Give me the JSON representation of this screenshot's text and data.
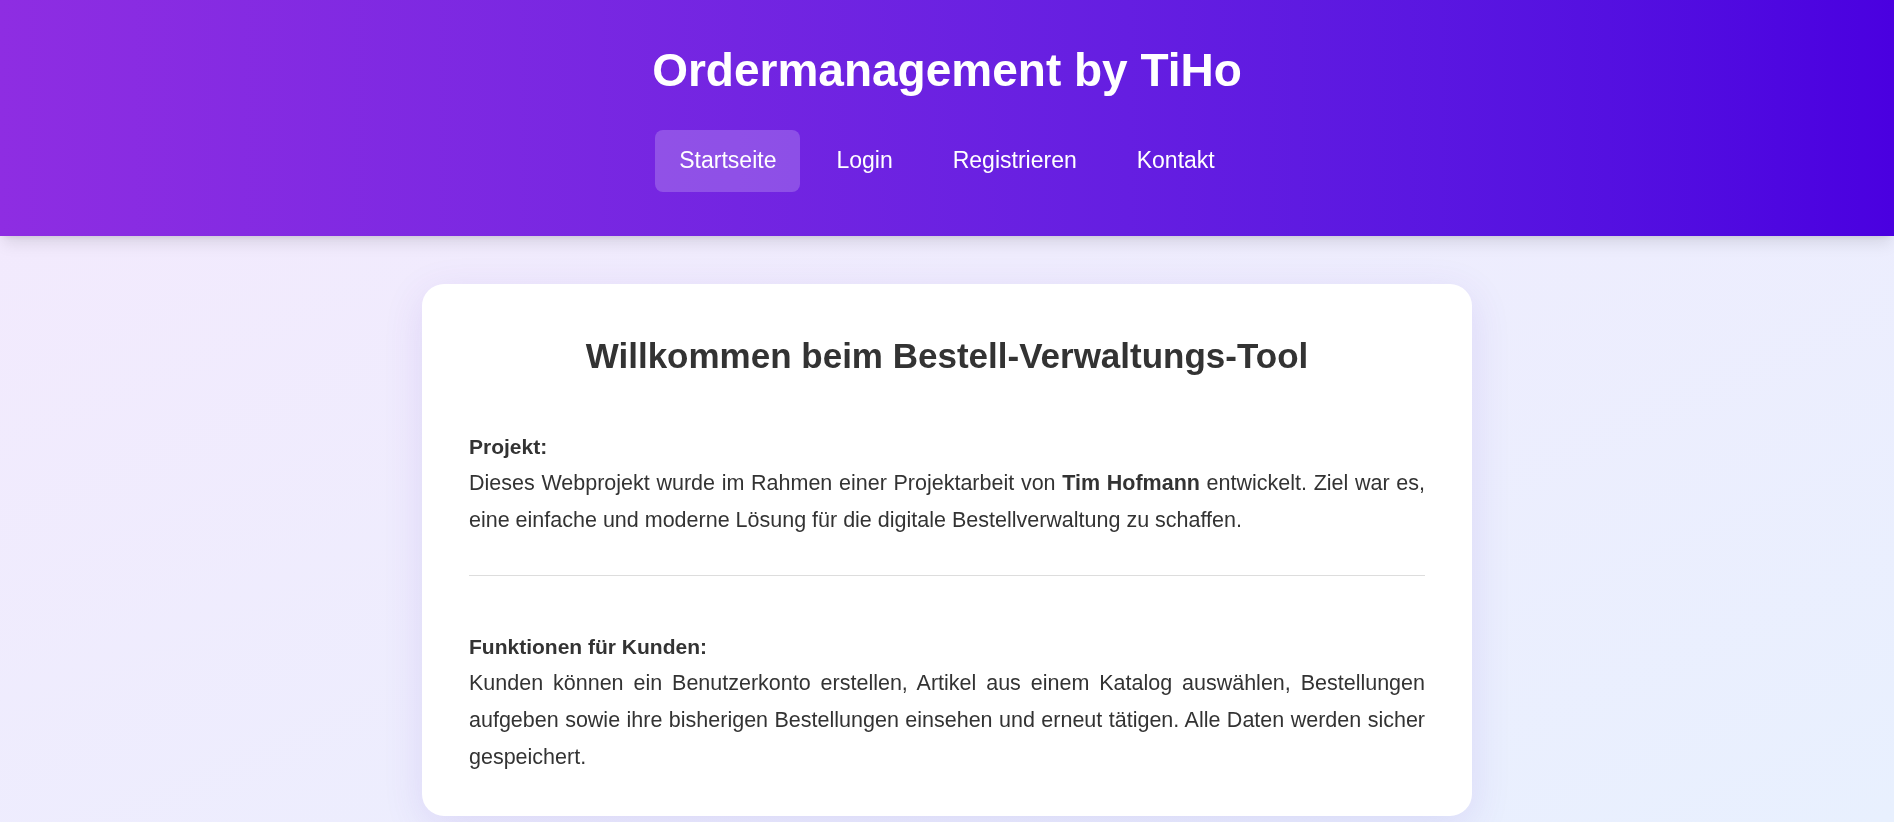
{
  "header": {
    "title": "Ordermanagement by TiHo",
    "nav": [
      {
        "label": "Startseite",
        "selected": true
      },
      {
        "label": "Login",
        "selected": false
      },
      {
        "label": "Registrieren",
        "selected": false
      },
      {
        "label": "Kontakt",
        "selected": false
      }
    ]
  },
  "card": {
    "heading": "Willkommen beim Bestell-Verwaltungs-Tool",
    "sections": [
      {
        "title": "Projekt:",
        "text": "Dieses Webprojekt wurde im Rahmen einer Projektarbeit von **Tim Hofmann** entwickelt. Ziel war es, eine einfache und moderne Lösung für die digitale Bestellverwaltung zu schaffen."
      },
      {
        "title": "Funktionen für Kunden:",
        "text": "Kunden können ein Benutzerkonto erstellen, Artikel aus einem Katalog auswählen, Bestellungen aufgeben sowie ihre bisherigen Bestellungen einsehen und erneut tätigen. Alle Daten werden sicher gespeichert."
      }
    ]
  }
}
